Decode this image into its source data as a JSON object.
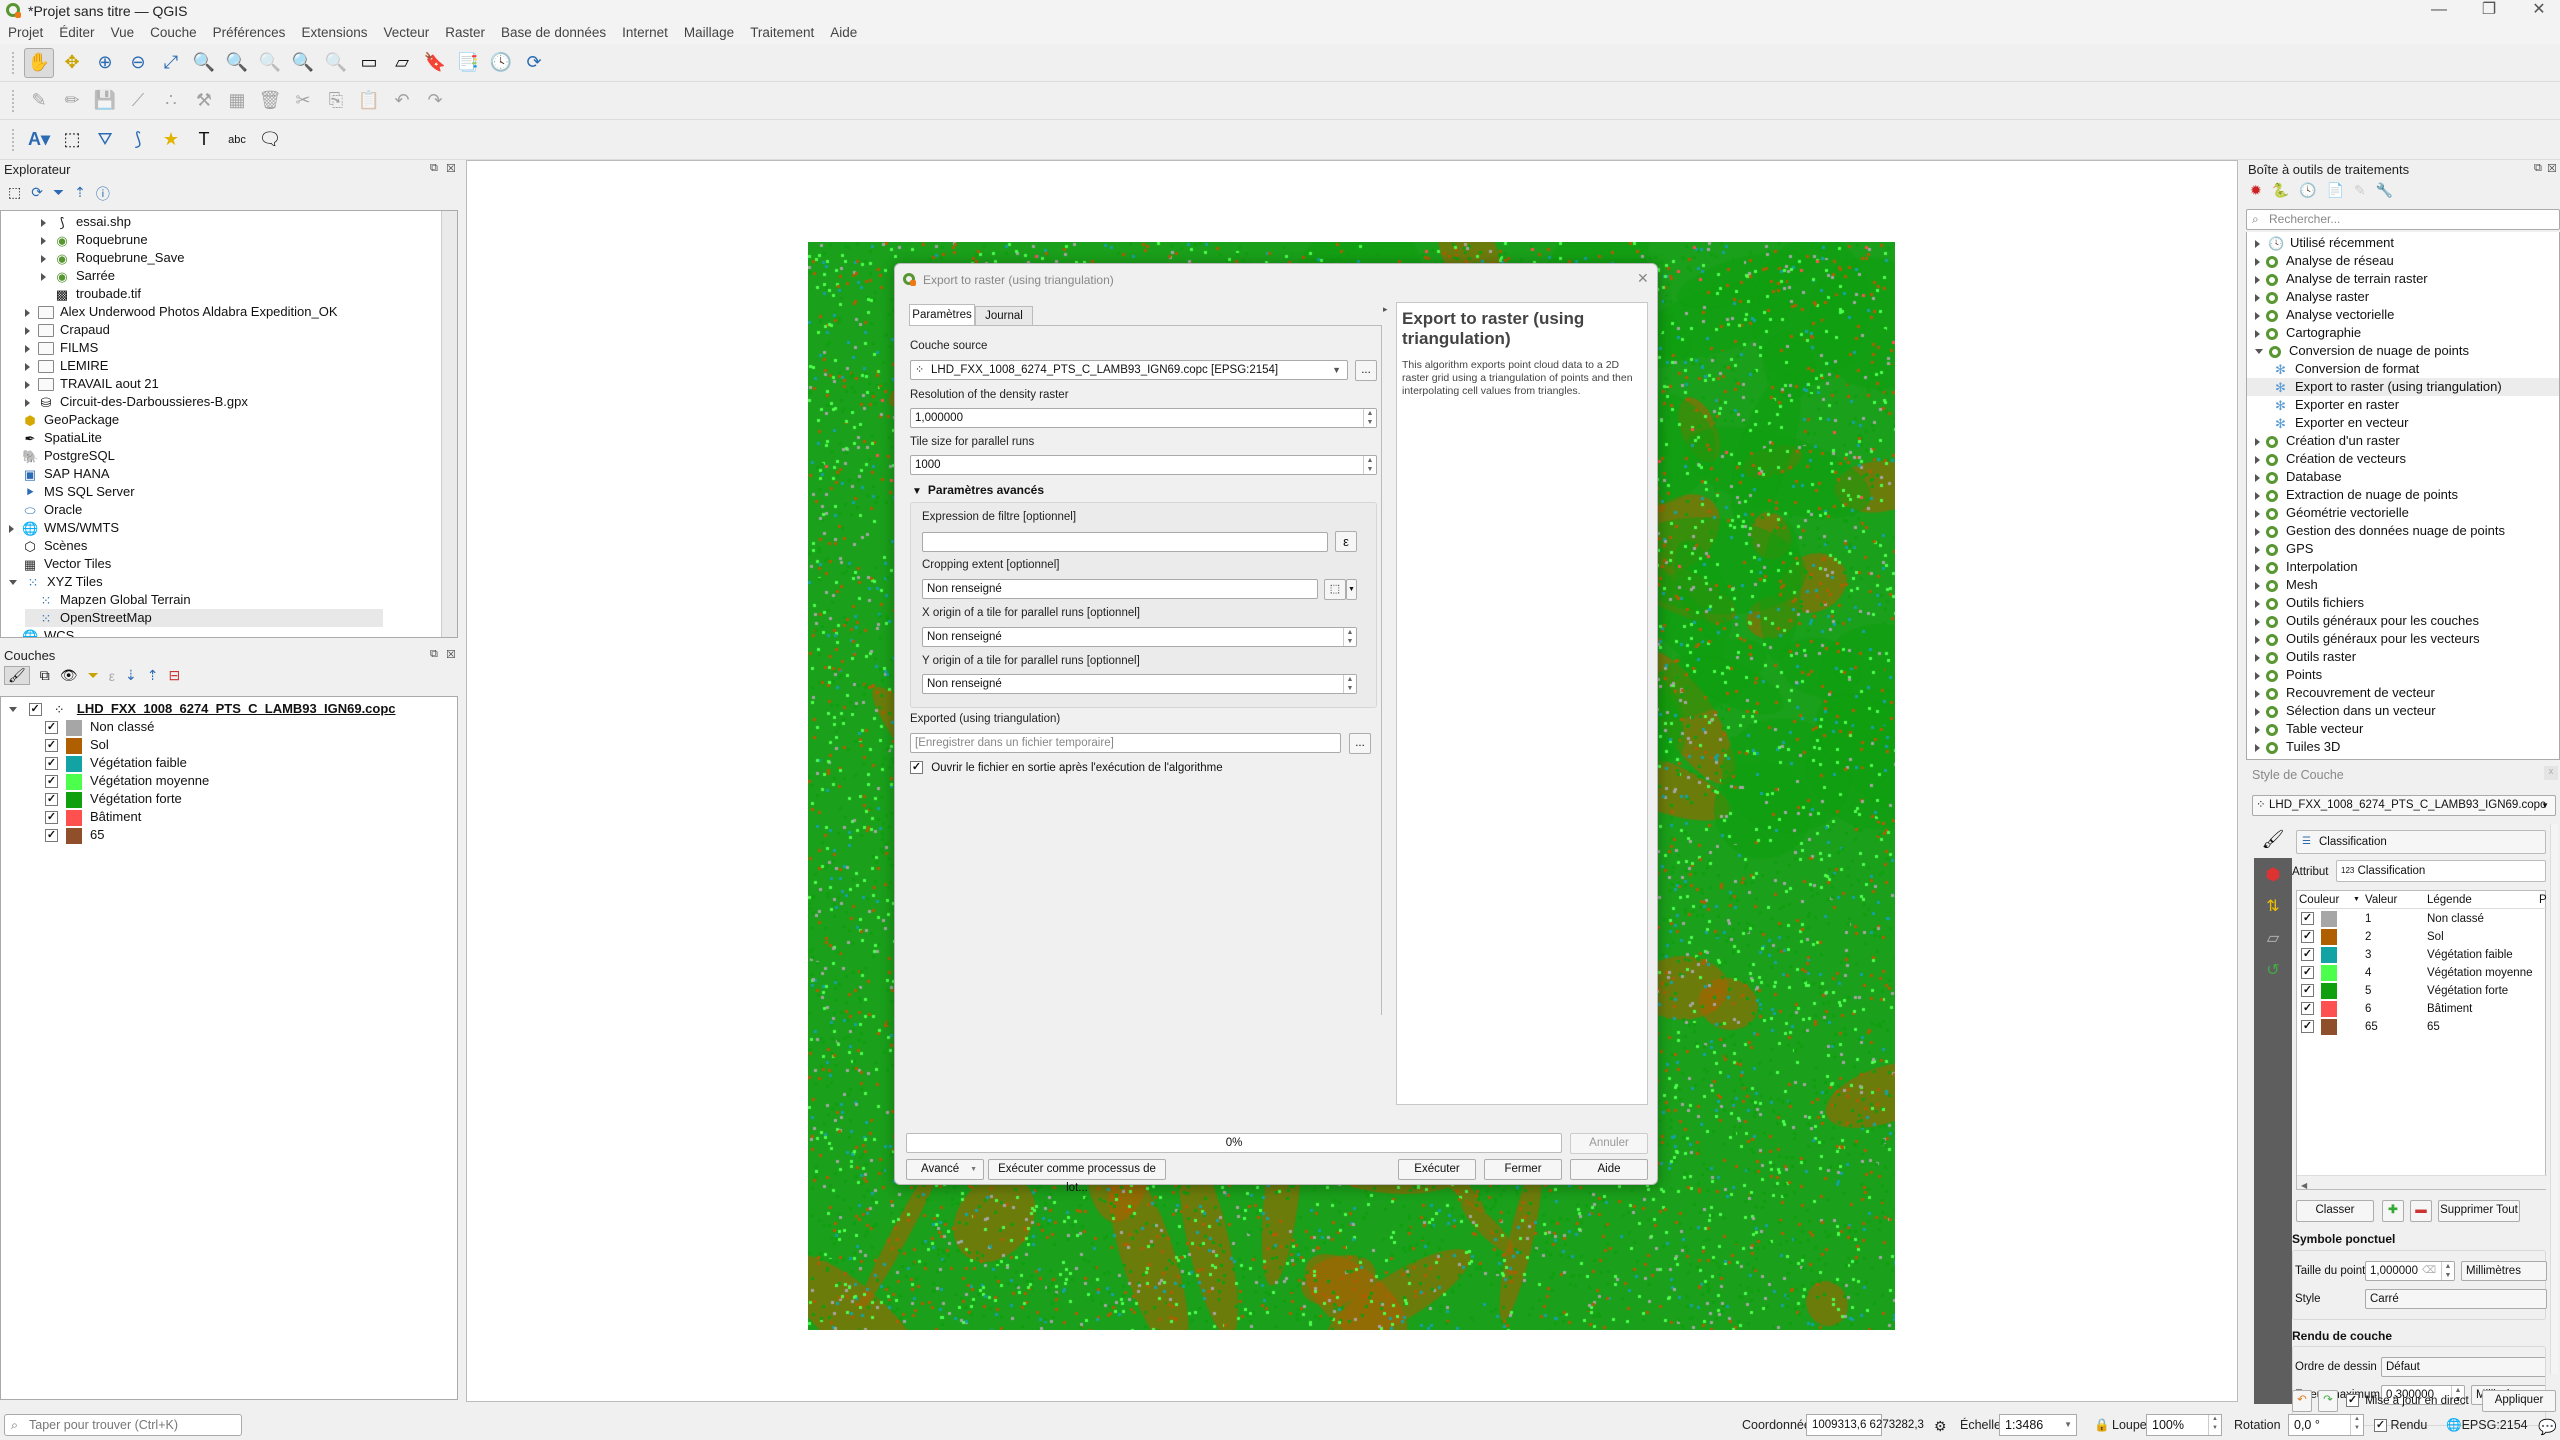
{
  "window": {
    "title": "*Projet sans titre — QGIS",
    "minimize_icon": "minimize-icon",
    "maximize_icon": "restore-icon",
    "close_icon": "close-icon"
  },
  "menu": [
    "Projet",
    "Éditer",
    "Vue",
    "Couche",
    "Préférences",
    "Extensions",
    "Vecteur",
    "Raster",
    "Base de données",
    "Internet",
    "Maillage",
    "Traitement",
    "Aide"
  ],
  "toolbars": {
    "navigation": [
      "pan-icon",
      "pan-to-selection-icon",
      "zoom-in-icon",
      "zoom-out-icon",
      "zoom-full-icon",
      "zoom-to-selection-icon",
      "zoom-to-layer-icon",
      "zoom-native-icon",
      "zoom-last-icon",
      "zoom-next-icon",
      "new-map-view-icon",
      "new-3d-view-icon",
      "new-bookmark-icon",
      "show-bookmarks-icon",
      "temporal-controller-icon",
      "refresh-icon"
    ],
    "digitizing": [
      "current-edits-icon",
      "toggle-editing-icon",
      "save-edits-icon",
      "add-line-icon",
      "vertex-tool-icon",
      "modify-attributes-icon",
      "delete-selected-icon",
      "cut-icon",
      "copy-icon",
      "paste-icon",
      "undo-icon",
      "redo-icon"
    ],
    "labels": [
      "label-options-icon",
      "select-label-icon",
      "add-polygon-icon",
      "add-line-feature-icon",
      "add-point-icon",
      "add-text-annotation-icon",
      "move-label-icon",
      "text-annotation-icon"
    ]
  },
  "explorer": {
    "title": "Explorateur",
    "items": [
      {
        "label": "essai.shp",
        "icon": "shapefile-icon",
        "indent": 2,
        "expander": "collapsed"
      },
      {
        "label": "Roquebrune",
        "icon": "qgis-project-icon",
        "indent": 2,
        "expander": "collapsed"
      },
      {
        "label": "Roquebrune_Save",
        "icon": "qgis-project-icon",
        "indent": 2,
        "expander": "collapsed"
      },
      {
        "label": "Sarrée",
        "icon": "qgis-project-icon",
        "indent": 2,
        "expander": "collapsed"
      },
      {
        "label": "troubade.tif",
        "icon": "raster-icon",
        "indent": 2,
        "expander": "none"
      },
      {
        "label": "Alex Underwood Photos Aldabra Expedition_OK",
        "icon": "folder-icon",
        "indent": 1,
        "expander": "collapsed"
      },
      {
        "label": "Crapaud",
        "icon": "folder-icon",
        "indent": 1,
        "expander": "collapsed"
      },
      {
        "label": "FILMS",
        "icon": "folder-icon",
        "indent": 1,
        "expander": "collapsed"
      },
      {
        "label": "LEMIRE",
        "icon": "folder-icon",
        "indent": 1,
        "expander": "collapsed"
      },
      {
        "label": "TRAVAIL aout 21",
        "icon": "folder-icon",
        "indent": 1,
        "expander": "collapsed"
      },
      {
        "label": "Circuit-des-Darboussieres-B.gpx",
        "icon": "database-icon",
        "indent": 1,
        "expander": "collapsed"
      },
      {
        "label": "GeoPackage",
        "icon": "geopackage-icon",
        "indent": 0,
        "expander": "none"
      },
      {
        "label": "SpatiaLite",
        "icon": "spatialite-icon",
        "indent": 0,
        "expander": "none"
      },
      {
        "label": "PostgreSQL",
        "icon": "postgresql-icon",
        "indent": 0,
        "expander": "none"
      },
      {
        "label": "SAP HANA",
        "icon": "sap-hana-icon",
        "indent": 0,
        "expander": "none"
      },
      {
        "label": "MS SQL Server",
        "icon": "mssql-icon",
        "indent": 0,
        "expander": "none"
      },
      {
        "label": "Oracle",
        "icon": "oracle-icon",
        "indent": 0,
        "expander": "none"
      },
      {
        "label": "WMS/WMTS",
        "icon": "globe-icon",
        "indent": 0,
        "expander": "collapsed"
      },
      {
        "label": "Scènes",
        "icon": "scene-icon",
        "indent": 0,
        "expander": "none"
      },
      {
        "label": "Vector Tiles",
        "icon": "vector-tiles-icon",
        "indent": 0,
        "expander": "none"
      },
      {
        "label": "XYZ Tiles",
        "icon": "xyz-tiles-icon",
        "indent": 0,
        "expander": "expanded"
      },
      {
        "label": "Mapzen Global Terrain",
        "icon": "xyz-tiles-icon",
        "indent": 1,
        "expander": "none"
      },
      {
        "label": "OpenStreetMap",
        "icon": "xyz-tiles-icon",
        "indent": 1,
        "expander": "none",
        "selected": true
      },
      {
        "label": "WCS",
        "icon": "globe-icon",
        "indent": 0,
        "expander": "none"
      }
    ]
  },
  "layers": {
    "title": "Couches",
    "layer_name": "LHD_FXX_1008_6274_PTS_C_LAMB93_IGN69.copc",
    "classes": [
      {
        "label": "Non classé",
        "color": "#a6a6a6",
        "checked": true
      },
      {
        "label": "Sol",
        "color": "#b05f00",
        "checked": true
      },
      {
        "label": "Végétation faible",
        "color": "#14a3a5",
        "checked": true
      },
      {
        "label": "Végétation moyenne",
        "color": "#4dff4d",
        "checked": true
      },
      {
        "label": "Végétation forte",
        "color": "#0f9f0f",
        "checked": true
      },
      {
        "label": "Bâtiment",
        "color": "#ff5050",
        "checked": true
      },
      {
        "label": "65",
        "color": "#8f4f2a",
        "checked": true
      }
    ]
  },
  "dialog": {
    "title": "Export to raster (using triangulation)",
    "tabs": [
      "Paramètres",
      "Journal"
    ],
    "active_tab": 0,
    "source_label": "Couche source",
    "source_value": "LHD_FXX_1008_6274_PTS_C_LAMB93_IGN69.copc [EPSG:2154]",
    "browse_label": "...",
    "resolution_label": "Resolution of the density raster",
    "resolution_value": "1,000000",
    "tile_size_label": "Tile size for parallel runs",
    "tile_size_value": "1000",
    "advanced_label": "Paramètres avancés",
    "filter_label": "Expression de filtre [optionnel]",
    "filter_value": "",
    "expression_button": "ε",
    "crop_label": "Cropping extent [optionnel]",
    "crop_value": "Non renseigné",
    "xorigin_label": "X origin of a tile for parallel runs [optionnel]",
    "xorigin_value": "Non renseigné",
    "yorigin_label": "Y origin of a tile for parallel runs [optionnel]",
    "yorigin_value": "Non renseigné",
    "output_label": "Exported (using triangulation)",
    "output_placeholder": "[Enregistrer dans un fichier temporaire]",
    "open_output_label": "Ouvrir le fichier en sortie après l'exécution de l'algorithme",
    "open_output_checked": true,
    "help_title": "Export to raster (using triangulation)",
    "help_text": "This algorithm exports point cloud data to a 2D raster grid using a triangulation of points and then interpolating cell values from triangles.",
    "progress_percent": 0,
    "progress_text": "0%",
    "cancel_label": "Annuler",
    "advanced_button": "Avancé",
    "batch_button": "Exécuter comme processus de lot...",
    "run_button": "Exécuter",
    "close_button": "Fermer",
    "help_button": "Aide"
  },
  "toolbox": {
    "title": "Boîte à outils de traitements",
    "search_placeholder": "Rechercher...",
    "items": [
      {
        "label": "Utilisé récemment",
        "type": "recent"
      },
      {
        "label": "Analyse de réseau",
        "type": "group"
      },
      {
        "label": "Analyse de terrain raster",
        "type": "group"
      },
      {
        "label": "Analyse raster",
        "type": "group"
      },
      {
        "label": "Analyse vectorielle",
        "type": "group"
      },
      {
        "label": "Cartographie",
        "type": "group"
      },
      {
        "label": "Conversion de nuage de points",
        "type": "group-open"
      },
      {
        "label": "Conversion de format",
        "type": "algo"
      },
      {
        "label": "Export to raster (using triangulation)",
        "type": "algo",
        "selected": true
      },
      {
        "label": "Exporter en raster",
        "type": "algo"
      },
      {
        "label": "Exporter en vecteur",
        "type": "algo"
      },
      {
        "label": "Création d'un raster",
        "type": "group"
      },
      {
        "label": "Création de vecteurs",
        "type": "group"
      },
      {
        "label": "Database",
        "type": "group"
      },
      {
        "label": "Extraction de nuage de points",
        "type": "group"
      },
      {
        "label": "Géométrie vectorielle",
        "type": "group"
      },
      {
        "label": "Gestion des données nuage de points",
        "type": "group"
      },
      {
        "label": "GPS",
        "type": "group"
      },
      {
        "label": "Interpolation",
        "type": "group"
      },
      {
        "label": "Mesh",
        "type": "group"
      },
      {
        "label": "Outils fichiers",
        "type": "group"
      },
      {
        "label": "Outils généraux pour les couches",
        "type": "group"
      },
      {
        "label": "Outils généraux pour les vecteurs",
        "type": "group"
      },
      {
        "label": "Outils raster",
        "type": "group"
      },
      {
        "label": "Points",
        "type": "group"
      },
      {
        "label": "Recouvrement de vecteur",
        "type": "group"
      },
      {
        "label": "Sélection dans un vecteur",
        "type": "group"
      },
      {
        "label": "Table vecteur",
        "type": "group"
      },
      {
        "label": "Tuiles 3D",
        "type": "group"
      }
    ]
  },
  "style": {
    "title": "Style de Couche",
    "layer": "LHD_FXX_1008_6274_PTS_C_LAMB93_IGN69.copc",
    "renderer": "Classification",
    "attribute_label": "Attribut",
    "attribute_value": "Classification",
    "columns": [
      "Couleur",
      "Valeur",
      "Légende",
      "P"
    ],
    "rows": [
      {
        "value": "1",
        "legend": "Non classé",
        "color": "#a6a6a6"
      },
      {
        "value": "2",
        "legend": "Sol",
        "color": "#b05f00"
      },
      {
        "value": "3",
        "legend": "Végétation faible",
        "color": "#14a3a5"
      },
      {
        "value": "4",
        "legend": "Végétation moyenne",
        "color": "#4dff4d"
      },
      {
        "value": "5",
        "legend": "Végétation forte",
        "color": "#0f9f0f"
      },
      {
        "value": "6",
        "legend": "Bâtiment",
        "color": "#ff5050"
      },
      {
        "value": "65",
        "legend": "65",
        "color": "#8f4f2a"
      }
    ],
    "classify_button": "Classer",
    "delete_all_button": "Supprimer Tout",
    "point_symbol_heading": "Symbole ponctuel",
    "point_size_label": "Taille du point",
    "point_size_value": "1,000000",
    "point_size_unit": "Millimètres",
    "style_label": "Style",
    "style_value": "Carré",
    "render_heading": "Rendu de couche",
    "draw_order_label": "Ordre de dessin",
    "draw_order_value": "Défaut",
    "max_error_label": "Erreur maximum",
    "max_error_value": "0,300000",
    "max_error_unit": "Millimètres",
    "live_update_label": "Mise à jour en direct",
    "live_update_checked": true,
    "apply_button": "Appliquer"
  },
  "statusbar": {
    "locator_placeholder": "Taper pour trouver (Ctrl+K)",
    "coord_label": "Coordonnée",
    "coord_value": "1009313,6  6273282,3",
    "scale_label": "Échelle",
    "scale_value": "1:3486",
    "magnifier_label": "Loupe",
    "magnifier_value": "100%",
    "rotation_label": "Rotation",
    "rotation_value": "0,0 °",
    "render_label": "Rendu",
    "render_checked": true,
    "crs_label": "EPSG:2154"
  }
}
